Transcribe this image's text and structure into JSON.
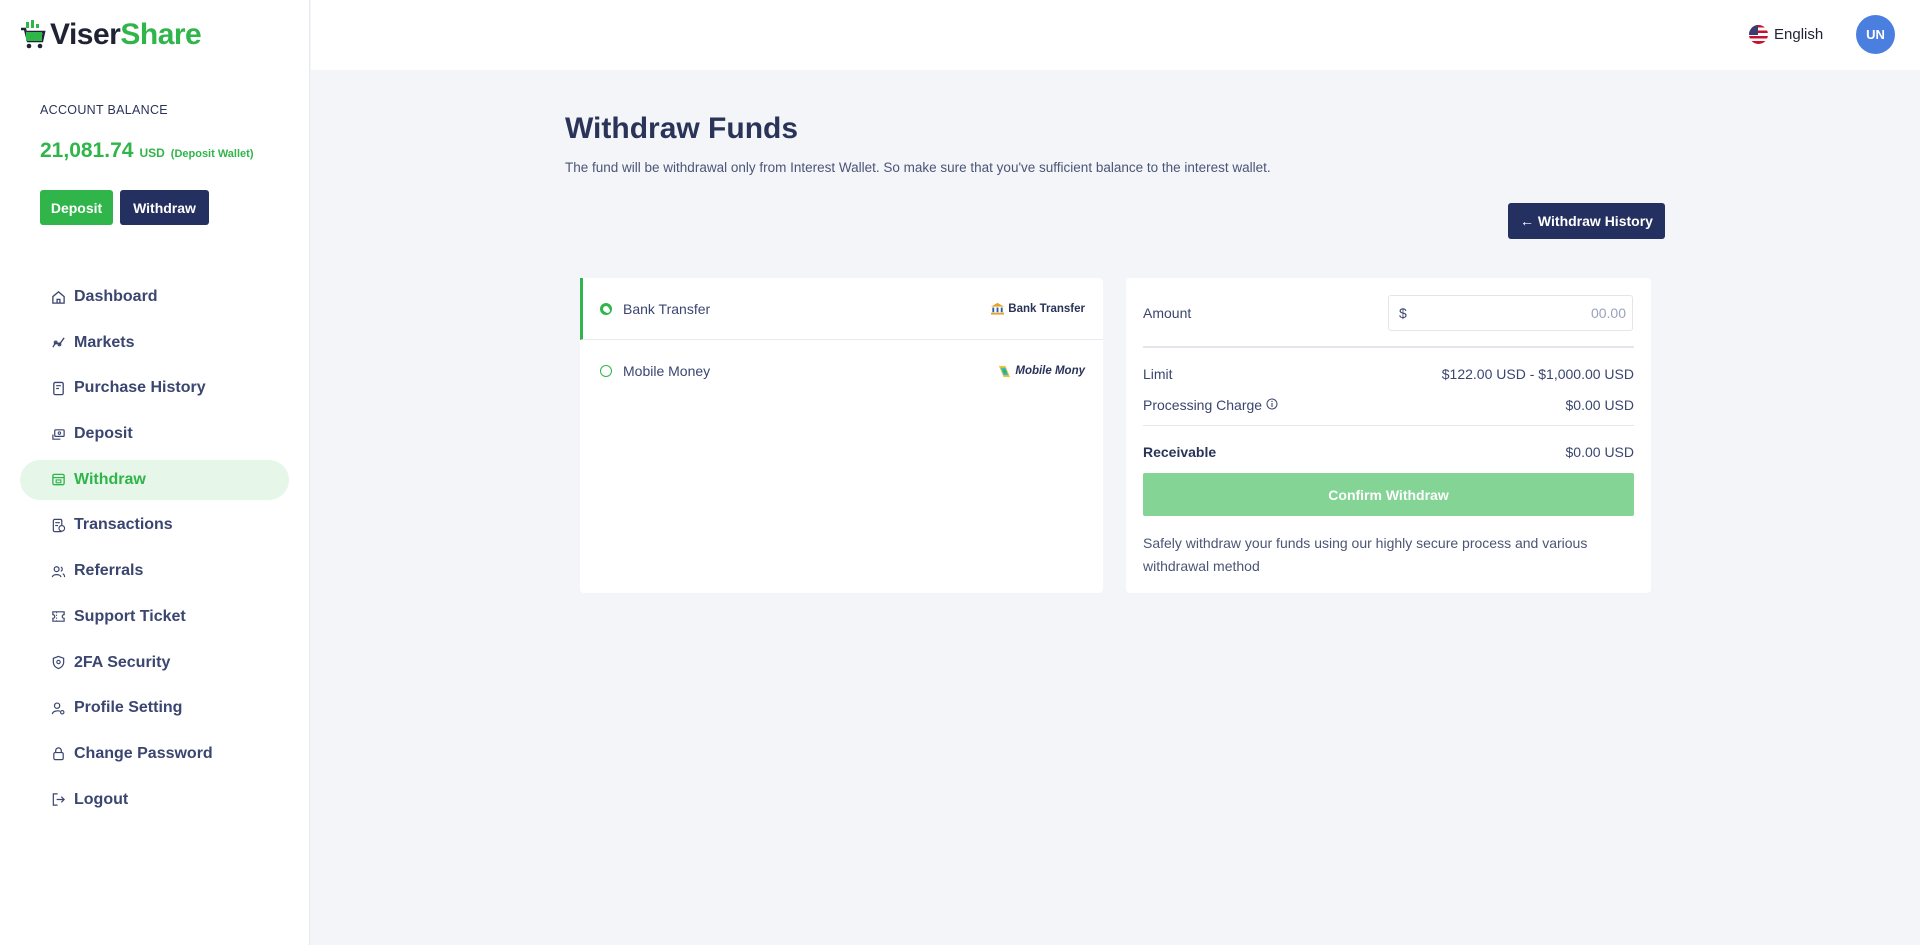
{
  "brand": {
    "part1": "Viser",
    "part2": "Share"
  },
  "sidebar": {
    "balance_label": "ACCOUNT BALANCE",
    "balance_amount": "21,081.74",
    "balance_currency": "USD",
    "balance_wallet": "(Deposit Wallet)",
    "deposit_label": "Deposit",
    "withdraw_label": "Withdraw",
    "items": [
      {
        "label": "Dashboard",
        "icon": "home-icon"
      },
      {
        "label": "Markets",
        "icon": "chart-icon"
      },
      {
        "label": "Purchase History",
        "icon": "receipt-icon"
      },
      {
        "label": "Deposit",
        "icon": "deposit-icon"
      },
      {
        "label": "Withdraw",
        "icon": "withdraw-icon",
        "active": true
      },
      {
        "label": "Transactions",
        "icon": "transactions-icon"
      },
      {
        "label": "Referrals",
        "icon": "users-icon"
      },
      {
        "label": "Support Ticket",
        "icon": "ticket-icon"
      },
      {
        "label": "2FA Security",
        "icon": "shield-icon"
      },
      {
        "label": "Profile Setting",
        "icon": "user-gear-icon"
      },
      {
        "label": "Change Password",
        "icon": "lock-icon"
      },
      {
        "label": "Logout",
        "icon": "logout-icon"
      }
    ]
  },
  "topbar": {
    "language": "English",
    "avatar_initials": "UN"
  },
  "main": {
    "title": "Withdraw Funds",
    "subtitle": "The fund will be withdrawal only from Interest Wallet. So make sure that you've sufficient balance to the interest wallet.",
    "history_button": "← Withdraw History",
    "methods": [
      {
        "name": "Bank Transfer",
        "logo_text": "Bank Transfer",
        "selected": true
      },
      {
        "name": "Mobile Money",
        "logo_text": "Mobile Mony",
        "selected": false
      }
    ],
    "amount_label": "Amount",
    "currency_symbol": "$",
    "amount_placeholder": "00.00",
    "limit_label": "Limit",
    "limit_value": "$122.00 USD - $1,000.00 USD",
    "charge_label": "Processing Charge",
    "charge_value": "$0.00 USD",
    "receivable_label": "Receivable",
    "receivable_value": "$0.00 USD",
    "confirm_button": "Confirm Withdraw",
    "note": "Safely withdraw your funds using our highly secure process and various withdrawal method"
  },
  "colors": {
    "accent": "#2fb54a",
    "navy": "#243160",
    "confirm_disabled": "#83d495"
  }
}
